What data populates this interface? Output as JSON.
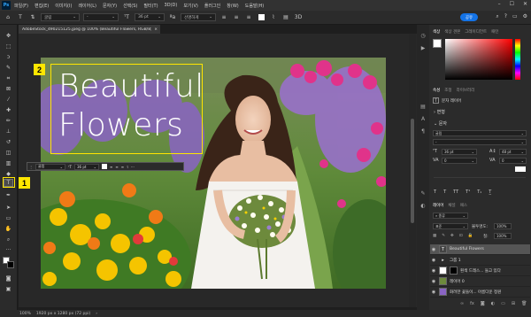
{
  "menubar": {
    "logo": "Ps",
    "items": [
      "파일(F)",
      "편집(E)",
      "이미지(I)",
      "레이어(L)",
      "문자(Y)",
      "선택(S)",
      "필터(T)",
      "3D(D)",
      "보기(V)",
      "플러그인",
      "창(W)",
      "도움말(H)"
    ]
  },
  "optbar": {
    "font_family": "굴림",
    "font_style": "-",
    "font_size": "36 pt",
    "antialias": "선명하게",
    "share_label": "공유"
  },
  "document": {
    "tab_title": "AdobeStock_490215125.jpeg @ 100% (Beautiful Flowers, RGB/8)",
    "headline_line1": "Beautiful",
    "headline_line2": "Flowers"
  },
  "floating_bar": {
    "font": "굴림",
    "size": "36 pt"
  },
  "badges": {
    "one": "1",
    "two": "2"
  },
  "status": {
    "zoom": "100%",
    "doc_info": "1920 px x 1280 px (72 ppi)"
  },
  "panels": {
    "color_tabs": [
      "색상",
      "색상 견본",
      "그레이디언트",
      "패턴"
    ],
    "props_tabs": [
      "속성",
      "조정",
      "라이브러리"
    ],
    "props_layer_label": "문자 레이어",
    "transform_title": "변형",
    "char_title": "문자",
    "char_font": "굴림",
    "char_size": "36 pt",
    "char_leading": "48 pt",
    "char_tracking": "0",
    "layers_tabs": [
      "레이어",
      "채널",
      "패스"
    ],
    "blend_mode": "표준",
    "opacity_label": "불투명도:",
    "opacity_value": "100%",
    "fill_label": "칠:",
    "fill_value": "100%"
  },
  "layers": [
    {
      "name": "Beautiful Flowers",
      "thumb": "T",
      "selected": true
    },
    {
      "name": "그룹 1",
      "thumb": "▸",
      "selected": false
    },
    {
      "name": "흰색 드레스... 들고 있다",
      "thumb": "",
      "selected": false
    },
    {
      "name": "레이어 0",
      "thumb": "",
      "selected": false
    },
    {
      "name": "화려한 꽃들이... 아름다운 정원",
      "thumb": "",
      "selected": false
    }
  ],
  "colors": {
    "accent": "#1473e6",
    "highlight": "#ffe600"
  }
}
